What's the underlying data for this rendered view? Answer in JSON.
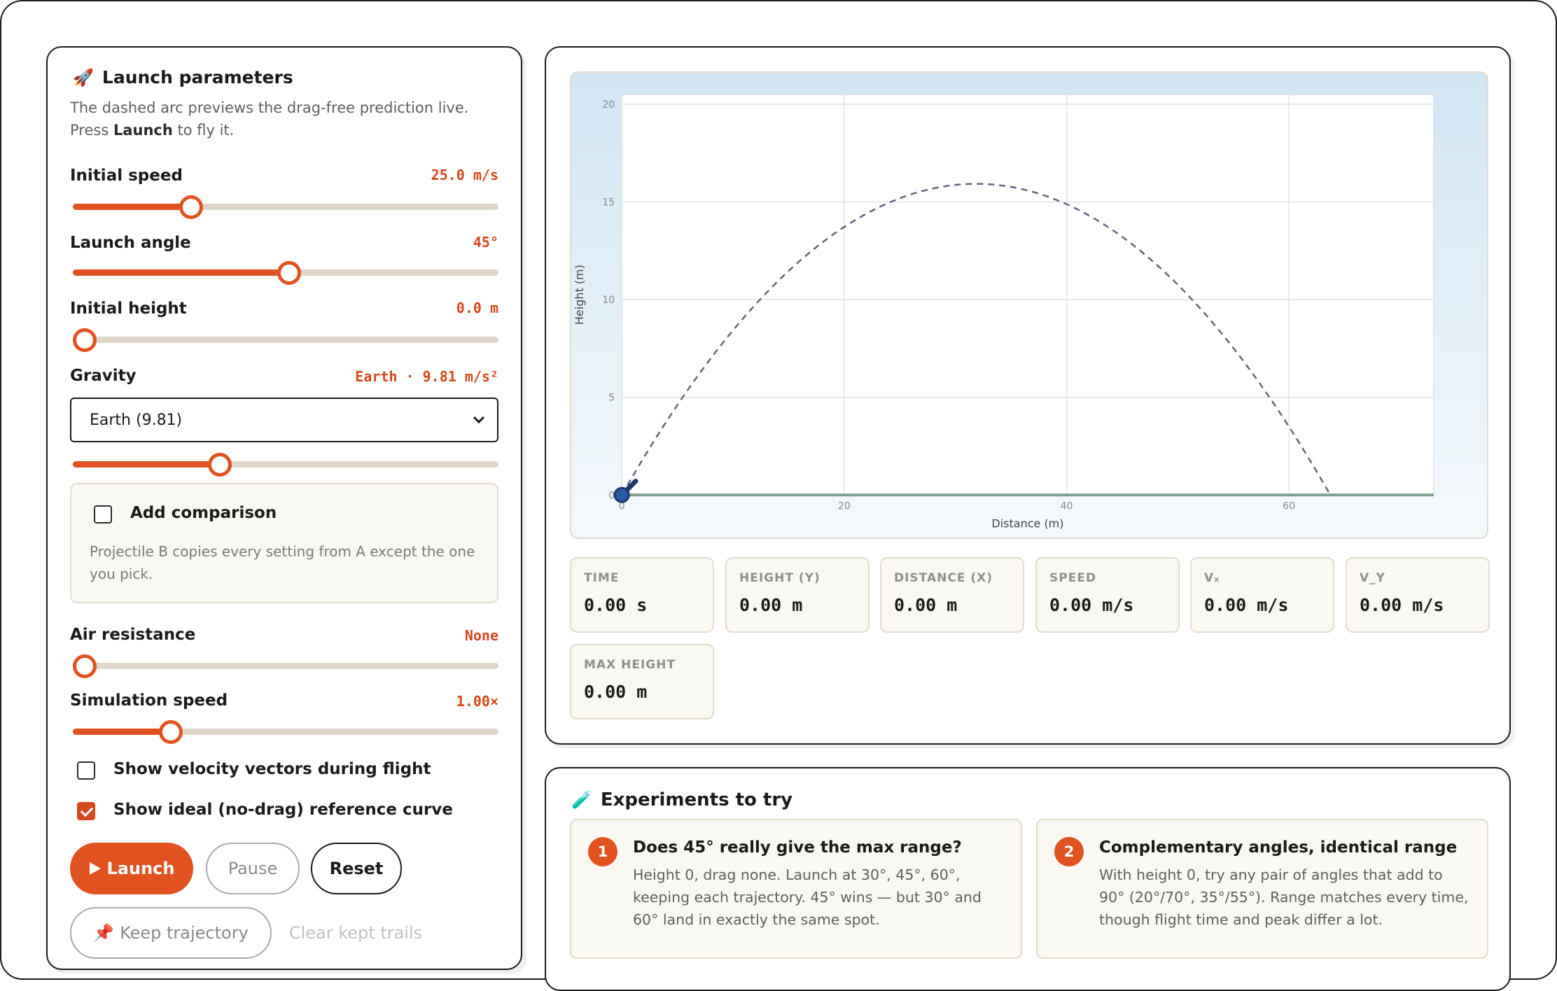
{
  "params": {
    "title": "Launch parameters",
    "icon": "rocket-icon",
    "desc_before": "The dashed arc previews the drag-free prediction live. Press ",
    "desc_bold": "Launch",
    "desc_after": " to fly it.",
    "initial_speed": {
      "label": "Initial speed",
      "value": "25.0 m/s",
      "fraction": 0.26
    },
    "launch_angle": {
      "label": "Launch angle",
      "value": "45°",
      "fraction": 0.5
    },
    "initial_height": {
      "label": "Initial height",
      "value": "0.0 m",
      "fraction": 0.0
    },
    "gravity": {
      "label": "Gravity",
      "value": "Earth · 9.81 m/s²",
      "selected": "Earth (9.81)",
      "fraction": 0.33
    },
    "comparison": {
      "label": "Add comparison",
      "checked": false,
      "desc": "Projectile B copies every setting from A except the one you pick."
    },
    "air_resistance": {
      "label": "Air resistance",
      "value": "None",
      "fraction": 0.0
    },
    "sim_speed": {
      "label": "Simulation speed",
      "value": "1.00×",
      "fraction": 0.21
    },
    "show_vectors": {
      "label": "Show velocity vectors during flight",
      "checked": false
    },
    "show_ideal": {
      "label": "Show ideal (no-drag) reference curve",
      "checked": true
    },
    "buttons": {
      "launch": "Launch",
      "pause": "Pause",
      "reset": "Reset",
      "keep": "Keep trajectory",
      "clear": "Clear kept trails"
    }
  },
  "chart_data": {
    "type": "line",
    "xlabel": "Distance (m)",
    "ylabel": "Height (m)",
    "x_ticks": [
      0,
      20,
      40,
      60
    ],
    "y_ticks": [
      0,
      5,
      10,
      15,
      20
    ],
    "xlim": [
      0,
      73
    ],
    "ylim": [
      0,
      20.5
    ],
    "preview": {
      "v0": 25.0,
      "angle_deg": 45,
      "h0": 0.0,
      "g": 9.81
    },
    "dashed_preview": true
  },
  "stats": [
    {
      "label": "TIME",
      "value": "0.00 s"
    },
    {
      "label": "HEIGHT (Y)",
      "value": "0.00 m"
    },
    {
      "label": "DISTANCE (X)",
      "value": "0.00 m"
    },
    {
      "label": "SPEED",
      "value": "0.00 m/s"
    },
    {
      "label": "Vₓ",
      "value": "0.00 m/s"
    },
    {
      "label": "V_Y",
      "value": "0.00 m/s"
    },
    {
      "label": "MAX HEIGHT",
      "value": "0.00 m"
    }
  ],
  "experiments": {
    "title": "Experiments to try",
    "icon": "test-tube-icon",
    "items": [
      {
        "num": "1",
        "title": "Does 45° really give the max range?",
        "desc": "Height 0, drag none. Launch at 30°, 45°, 60°, keeping each trajectory. 45° wins — but 30° and 60° land in exactly the same spot."
      },
      {
        "num": "2",
        "title": "Complementary angles, identical range",
        "desc": "With height 0, try any pair of angles that add to 90° (20°/70°, 35°/55°). Range matches every time, though flight time and peak differ a lot."
      }
    ]
  },
  "colors": {
    "accent": "#e05220",
    "accent_text": "#d4481d",
    "ground": "#7fa08e",
    "preview": "#5f6680",
    "cannon": "#1e3a6e"
  }
}
